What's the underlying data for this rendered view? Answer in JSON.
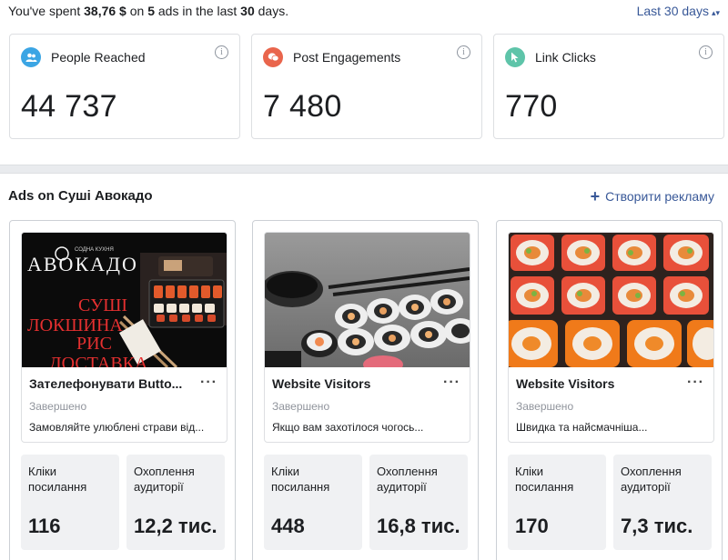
{
  "summary": {
    "prefix": "You've spent ",
    "amount": "38,76 $",
    "on": " on ",
    "ads_count": "5",
    "ads_text": " ads in the last ",
    "days": "30",
    "days_text": " days.",
    "period_label": "Last 30 days"
  },
  "metrics": [
    {
      "label": "People Reached",
      "value": "44 737",
      "icon": "people-icon",
      "color": "#3ba5e4"
    },
    {
      "label": "Post Engagements",
      "value": "7 480",
      "icon": "chat-bubble-icon",
      "color": "#e9654c"
    },
    {
      "label": "Link Clicks",
      "value": "770",
      "icon": "cursor-icon",
      "color": "#5ec4a9"
    }
  ],
  "ads_section": {
    "title": "Ads on Суші Авокадо",
    "create_label": "Створити рекламу"
  },
  "ads": [
    {
      "name": "Зателефонувати Butto...",
      "status": "Завершено",
      "description": "Замовляйте улюблені страви від...",
      "image": {
        "brand": "АВОКАДО",
        "tagline": "СОДНА КУХНЯ",
        "line1": "СУШІ",
        "line2": "ЛОКШИНА",
        "line3": "РИС",
        "line4": "ДОСТАВКА"
      },
      "clicks_label": "Кліки посилання",
      "clicks": "116",
      "reach_label": "Охоплення аудиторії",
      "reach": "12,2 тис."
    },
    {
      "name": "Website Visitors",
      "status": "Завершено",
      "description": "Якщо вам захотілося чогось...",
      "clicks_label": "Кліки посилання",
      "clicks": "448",
      "reach_label": "Охоплення аудиторії",
      "reach": "16,8 тис."
    },
    {
      "name": "Website Visitors",
      "status": "Завершено",
      "description": "Швидка та найсмачніша...",
      "clicks_label": "Кліки посилання",
      "clicks": "170",
      "reach_label": "Охоплення аудиторії",
      "reach": "7,3 тис."
    }
  ]
}
